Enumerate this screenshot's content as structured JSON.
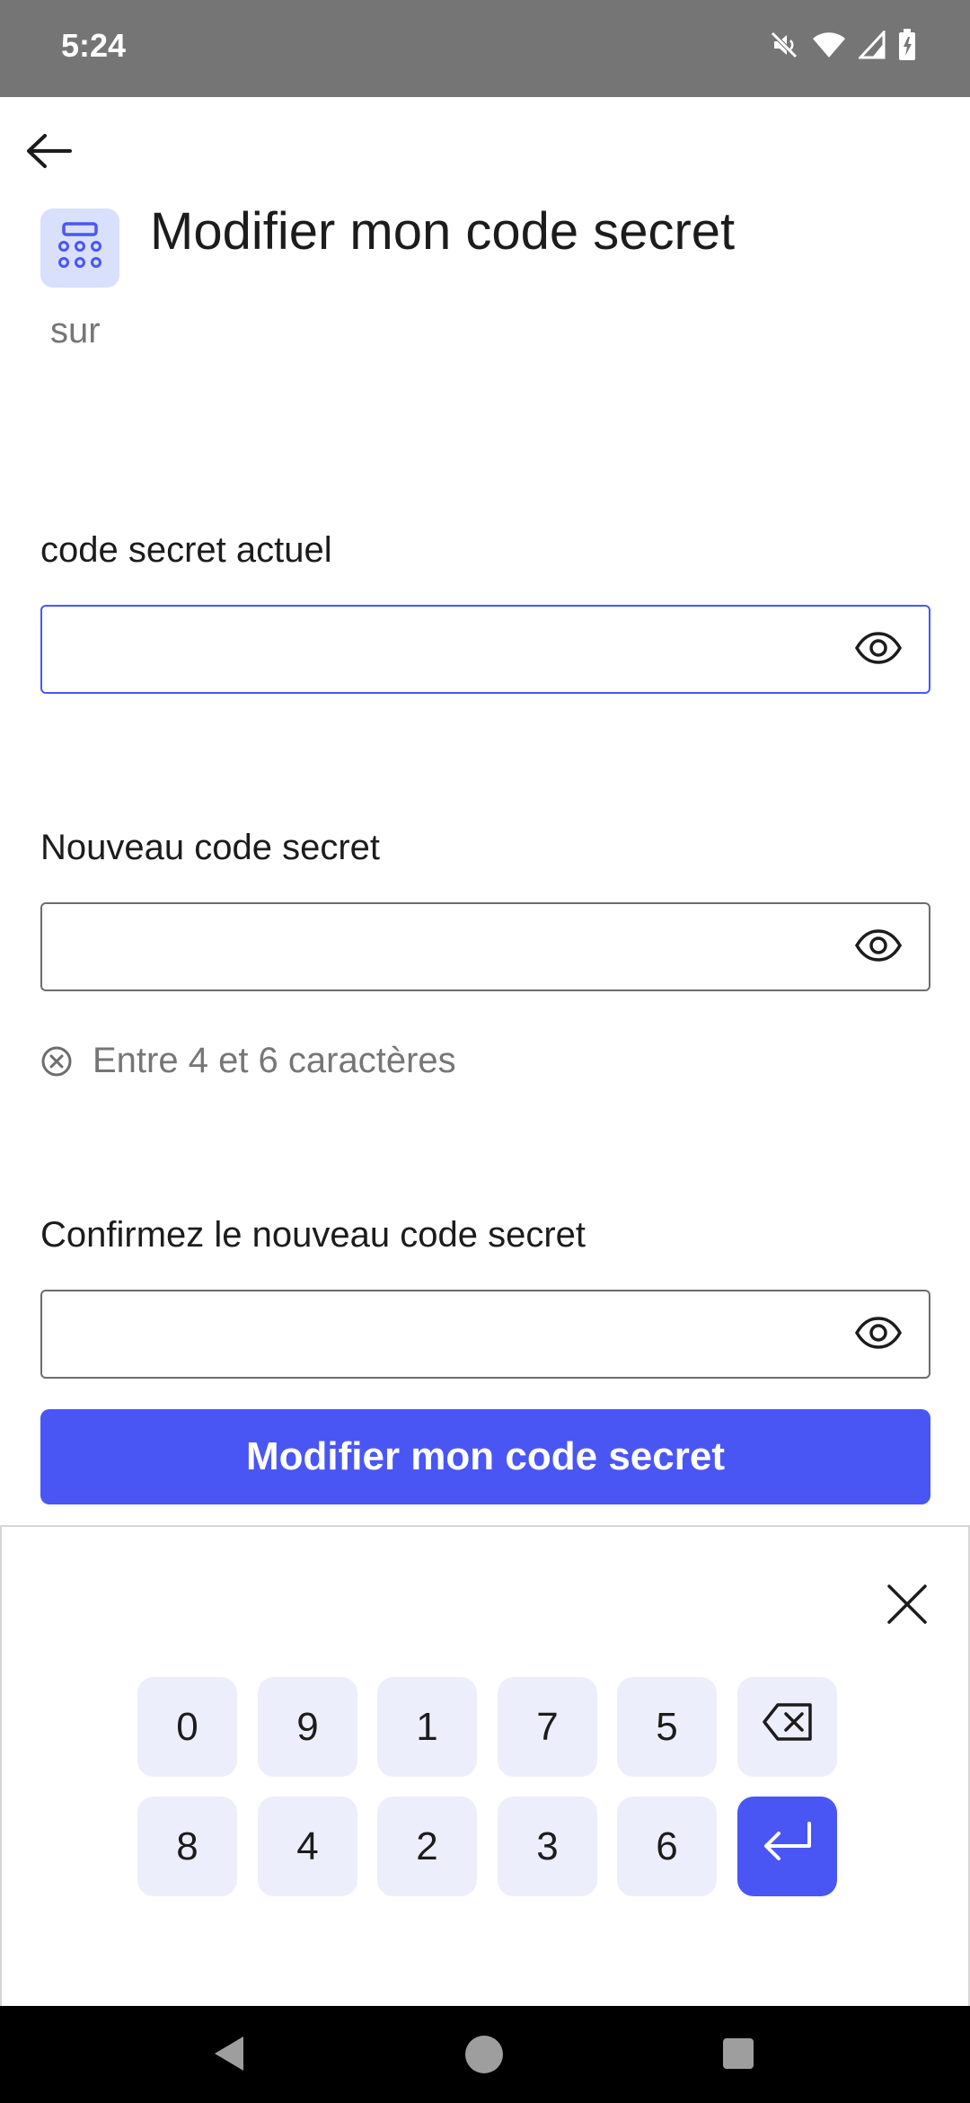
{
  "status_bar": {
    "time": "5:24",
    "icons": [
      "mute-icon",
      "wifi-icon",
      "signal-icon",
      "battery-icon"
    ]
  },
  "header": {
    "back_icon": "arrow-left-icon",
    "app_icon": "keypad-icon",
    "title": "Modifier mon code secret",
    "subtitle": "sur"
  },
  "form": {
    "current": {
      "label": "code secret actuel",
      "value": "",
      "toggle_icon": "eye-icon"
    },
    "new": {
      "label": "Nouveau code secret",
      "value": "",
      "toggle_icon": "eye-icon"
    },
    "rule": {
      "icon": "circle-x-icon",
      "text": "Entre 4 et 6 caractères"
    },
    "confirm": {
      "label": "Confirmez le nouveau code secret",
      "value": "",
      "toggle_icon": "eye-icon"
    },
    "submit_label": "Modifier mon code secret"
  },
  "keypad": {
    "close_icon": "close-icon",
    "row1": [
      "0",
      "9",
      "1",
      "7",
      "5"
    ],
    "row2": [
      "8",
      "4",
      "2",
      "3",
      "6"
    ],
    "backspace_icon": "backspace-icon",
    "enter_icon": "enter-icon"
  },
  "colors": {
    "accent": "#4a56f4",
    "key_bg": "#eceefb",
    "icon_bg": "#d9e0fb",
    "status_bar": "#757575"
  }
}
